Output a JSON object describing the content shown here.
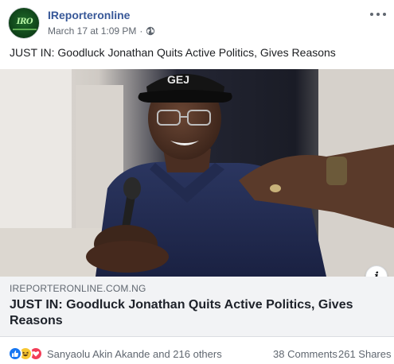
{
  "post": {
    "page_name": "IReporteronline",
    "timestamp": "March 17 at 1:09 PM",
    "separator": "·",
    "privacy_icon": "globe-icon",
    "more_icon": "more-options-icon",
    "text": "JUST IN: Goodluck Jonathan Quits Active Politics, Gives Reasons",
    "avatar_logo_text": "IRO",
    "image_cap_text": "GEJ"
  },
  "link": {
    "domain": "IREPORTERONLINE.COM.NG",
    "title": "JUST IN: Goodluck Jonathan Quits Active Politics, Gives Reasons",
    "info_label": "i"
  },
  "footer": {
    "reaction_icons": [
      "like-icon",
      "haha-icon",
      "love-icon"
    ],
    "reactors": "Sanyaolu Akin Akande and 216 others",
    "comments": "38 Comments",
    "shares": "261 Shares"
  },
  "colors": {
    "page_name": "#385898",
    "secondary_text": "#606770",
    "link_box_bg": "#f2f3f5",
    "like": "#1877f2",
    "haha": "#f7c733",
    "love": "#f33e58"
  }
}
